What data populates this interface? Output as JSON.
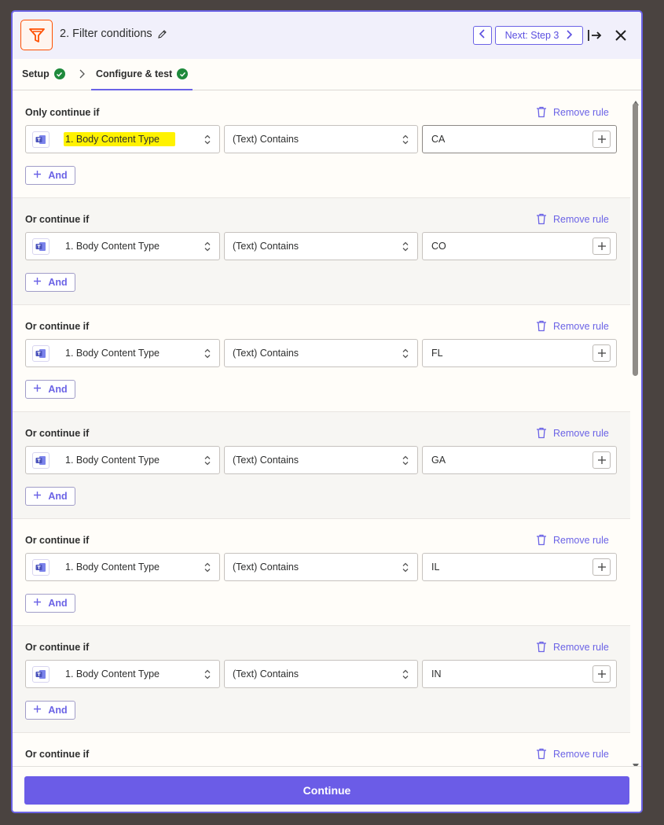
{
  "header": {
    "title": "2. Filter conditions",
    "next_label": "Next: Step 3"
  },
  "tabs": [
    {
      "label": "Setup",
      "completed": true
    },
    {
      "label": "Configure & test",
      "completed": true,
      "active": true
    }
  ],
  "rules": [
    {
      "title": "Only continue if",
      "field": "1. Body Content Type",
      "condition": "(Text) Contains",
      "value": "CA",
      "remove_label": "Remove rule",
      "and_label": "And"
    },
    {
      "title": "Or continue if",
      "field": "1. Body Content Type",
      "condition": "(Text) Contains",
      "value": "CO",
      "remove_label": "Remove rule",
      "and_label": "And"
    },
    {
      "title": "Or continue if",
      "field": "1. Body Content Type",
      "condition": "(Text) Contains",
      "value": "FL",
      "remove_label": "Remove rule",
      "and_label": "And"
    },
    {
      "title": "Or continue if",
      "field": "1. Body Content Type",
      "condition": "(Text) Contains",
      "value": "GA",
      "remove_label": "Remove rule",
      "and_label": "And"
    },
    {
      "title": "Or continue if",
      "field": "1. Body Content Type",
      "condition": "(Text) Contains",
      "value": "IL",
      "remove_label": "Remove rule",
      "and_label": "And"
    },
    {
      "title": "Or continue if",
      "field": "1. Body Content Type",
      "condition": "(Text) Contains",
      "value": "IN",
      "remove_label": "Remove rule",
      "and_label": "And"
    },
    {
      "title": "Or continue if",
      "field": "",
      "condition": "",
      "value": "",
      "remove_label": "Remove rule",
      "and_label": ""
    }
  ],
  "footer": {
    "continue_label": "Continue"
  },
  "colors": {
    "accent": "#6b63e6",
    "brand_orange": "#ff4f00",
    "success": "#1f8a3c",
    "highlight": "#fff200"
  },
  "icons": {
    "app": "filter-icon",
    "field_app": "microsoft-teams-icon"
  }
}
